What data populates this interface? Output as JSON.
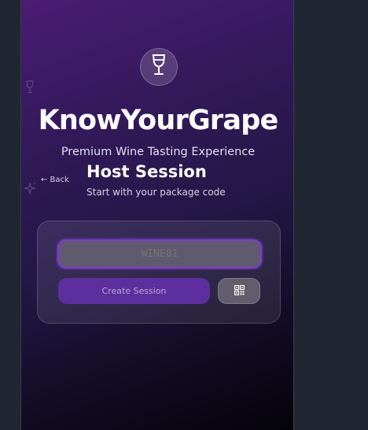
{
  "app": {
    "title": "KnowYourGrape",
    "subtitle": "Premium Wine Tasting Experience"
  },
  "nav": {
    "back_label": "← Back"
  },
  "session": {
    "heading": "Host Session",
    "subheading": "Start with your package code"
  },
  "form": {
    "code_placeholder": "WINE01",
    "code_value": "",
    "create_label": "Create Session"
  },
  "icons": {
    "logo": "wine-glass-icon",
    "qr": "qr-code-icon",
    "background_glass": "wine-glass-icon",
    "background_sparkle": "sparkle-icon"
  },
  "colors": {
    "accent": "#7d3fd0",
    "button": "#5d2f9e",
    "background_top": "#4b1c74",
    "background_bottom": "#04030a"
  }
}
